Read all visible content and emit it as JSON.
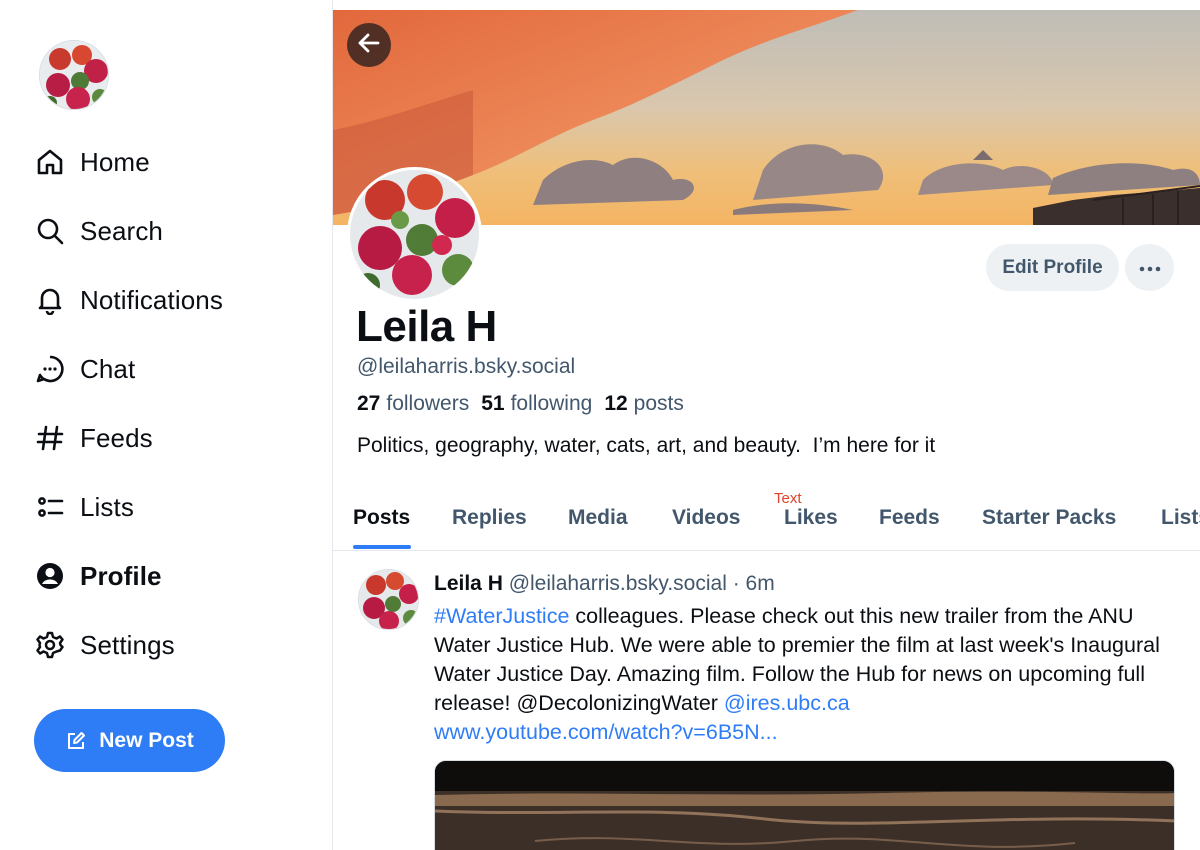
{
  "sidebar": {
    "items": [
      {
        "label": "Home",
        "icon": "home-icon"
      },
      {
        "label": "Search",
        "icon": "search-icon"
      },
      {
        "label": "Notifications",
        "icon": "bell-icon"
      },
      {
        "label": "Chat",
        "icon": "chat-icon"
      },
      {
        "label": "Feeds",
        "icon": "hash-icon"
      },
      {
        "label": "Lists",
        "icon": "list-icon"
      },
      {
        "label": "Profile",
        "icon": "user-circle-icon",
        "active": true
      },
      {
        "label": "Settings",
        "icon": "gear-icon"
      }
    ],
    "new_post_label": "New Post"
  },
  "profile": {
    "display_name": "Leila H",
    "handle": "@leilaharris.bsky.social",
    "followers_count": "27",
    "followers_label": "followers",
    "following_count": "51",
    "following_label": "following",
    "posts_count": "12",
    "posts_label": "posts",
    "bio": "Politics, geography, water, cats, art, and beauty.  I’m here for it",
    "edit_profile_label": "Edit Profile",
    "more_label": "···"
  },
  "tabs": [
    {
      "label": "Posts",
      "active": true
    },
    {
      "label": "Replies"
    },
    {
      "label": "Media"
    },
    {
      "label": "Videos"
    },
    {
      "label": "Likes"
    },
    {
      "label": "Feeds"
    },
    {
      "label": "Starter Packs"
    },
    {
      "label": "Lists"
    }
  ],
  "annotation_text": "Text",
  "post": {
    "author": "Leila H",
    "handle": "@leilaharris.bsky.social",
    "separator": " · ",
    "time": "6m",
    "hashtag": "#WaterJustice",
    "text_part1": " colleagues.  Please check out this new trailer from the ANU Water Justice Hub. We were able to premier the film at last week's Inaugural Water Justice Day. Amazing film. Follow the Hub for news on upcoming full release! @DecolonizingWater ",
    "mention_link": "@ires.ubc.ca",
    "url_link": "www.youtube.com/watch?v=6B5N..."
  },
  "colors": {
    "accent": "#2f7df6",
    "muted_text": "#42576c",
    "annotation": "#e0442c"
  }
}
